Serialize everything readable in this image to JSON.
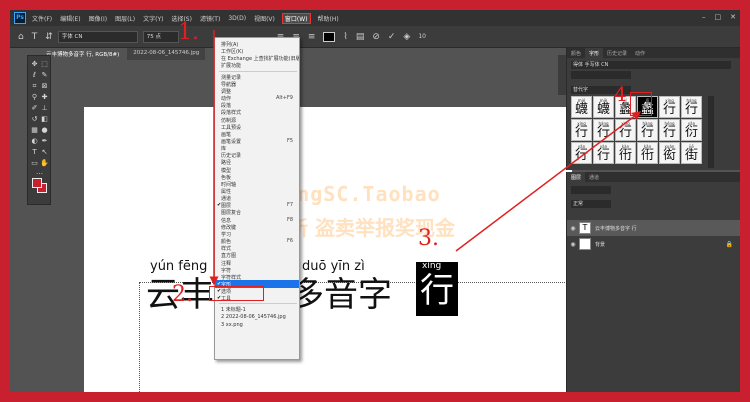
{
  "menubar": {
    "logo": "Ps",
    "items": [
      "文件(F)",
      "编辑(E)",
      "图像(I)",
      "图层(L)",
      "文字(Y)",
      "选择(S)",
      "滤镜(T)",
      "3D(D)",
      "视图(V)",
      "窗口(W)",
      "帮助(H)"
    ],
    "active_index": 9
  },
  "options": {
    "font": "字体 CN",
    "size": "75 点",
    "number": "10"
  },
  "doc_tabs": [
    "云丰博物多音字 行, RGB/8#)",
    "2022-08-06_145746.jpg"
  ],
  "canvas": {
    "pinyin_line": "yún fēng",
    "pinyin_line2": "duō yīn zì",
    "pinyin_sel": "xíng",
    "hanzi_left": "云丰",
    "hanzi_mid": "多音字",
    "hanzi_sel": "行",
    "watermark_1": "YunFengSC.Taobao",
    "watermark_2": "支持更新 盗卖举报奖现金"
  },
  "window_menu": {
    "items": [
      {
        "label": "排列(A)",
        "shortcut": ""
      },
      {
        "label": "工作区(K)",
        "shortcut": ""
      },
      {
        "label": "在 Exchange 上查找扩展功能(旧版)...",
        "shortcut": ""
      },
      {
        "label": "扩展功能",
        "shortcut": ""
      },
      {
        "label": "测量记录",
        "shortcut": ""
      },
      {
        "label": "导航器",
        "shortcut": ""
      },
      {
        "label": "调整",
        "shortcut": ""
      },
      {
        "label": "动作",
        "shortcut": "Alt+F9"
      },
      {
        "label": "段落",
        "shortcut": ""
      },
      {
        "label": "段落样式",
        "shortcut": ""
      },
      {
        "label": "仿制源",
        "shortcut": ""
      },
      {
        "label": "工具预设",
        "shortcut": ""
      },
      {
        "label": "画笔",
        "shortcut": ""
      },
      {
        "label": "画笔设置",
        "shortcut": "F5"
      },
      {
        "label": "库",
        "shortcut": ""
      },
      {
        "label": "历史记录",
        "shortcut": ""
      },
      {
        "label": "路径",
        "shortcut": ""
      },
      {
        "label": "模型",
        "shortcut": ""
      },
      {
        "label": "色板",
        "shortcut": ""
      },
      {
        "label": "时间轴",
        "shortcut": ""
      },
      {
        "label": "属性",
        "shortcut": ""
      },
      {
        "label": "通道",
        "shortcut": ""
      },
      {
        "label": "图层",
        "shortcut": "F7"
      },
      {
        "label": "图层复合",
        "shortcut": ""
      },
      {
        "label": "信息",
        "shortcut": "F8"
      },
      {
        "label": "修改键",
        "shortcut": ""
      },
      {
        "label": "学习",
        "shortcut": ""
      },
      {
        "label": "颜色",
        "shortcut": "F6"
      },
      {
        "label": "样式",
        "shortcut": ""
      },
      {
        "label": "直方图",
        "shortcut": ""
      },
      {
        "label": "注释",
        "shortcut": ""
      },
      {
        "label": "字符",
        "shortcut": ""
      },
      {
        "label": "字符样式",
        "shortcut": ""
      },
      {
        "label": "字形",
        "shortcut": ""
      },
      {
        "label": "选项",
        "shortcut": ""
      },
      {
        "label": "工具",
        "shortcut": ""
      },
      {
        "label": "1 未标题-1",
        "shortcut": ""
      },
      {
        "label": "2 2022-08-06_145746.jpg",
        "shortcut": ""
      },
      {
        "label": "3 xx.png",
        "shortcut": ""
      }
    ],
    "checked": [
      22,
      33,
      34,
      35
    ],
    "highlight_index": 33
  },
  "glyph_panel": {
    "tabs": [
      "颜色",
      "字形",
      "历史记录",
      "动作"
    ],
    "active_tab": 1,
    "font": "得体 手写体 CN",
    "filter": "替代字",
    "glyphs": [
      {
        "py": "mié",
        "ch": "蠛"
      },
      {
        "py": "miè",
        "ch": "蠛"
      },
      {
        "py": "lí",
        "ch": "蠡"
      },
      {
        "py": "lǐ",
        "ch": "蠡"
      },
      {
        "py": "xíng",
        "ch": "行"
      },
      {
        "py": "háng",
        "ch": "行"
      },
      {
        "py": "xíng",
        "ch": "行"
      },
      {
        "py": "háng",
        "ch": "行"
      },
      {
        "py": "xìng",
        "ch": "行"
      },
      {
        "py": "hàng",
        "ch": "行"
      },
      {
        "py": "héng",
        "ch": "行"
      },
      {
        "py": "yǎn",
        "ch": "衍"
      },
      {
        "py": "yǎn",
        "ch": "行"
      },
      {
        "py": "yán",
        "ch": "行"
      },
      {
        "py": "kàn",
        "ch": "衎"
      },
      {
        "py": "kǎn",
        "ch": "衎"
      },
      {
        "py": "xuàn",
        "ch": "衒"
      },
      {
        "py": "jiē",
        "ch": "街"
      }
    ],
    "selected_glyph": 3
  },
  "layers_panel": {
    "tabs": [
      "图层",
      "通道"
    ],
    "blend": "正常",
    "layers": [
      {
        "name": "云丰博物多音字 行",
        "thumb": "T",
        "selected": true
      },
      {
        "name": "背景",
        "thumb": "",
        "selected": false
      }
    ]
  },
  "annotations": {
    "n1": "1.",
    "n2": "2.",
    "n3": "3.",
    "n4": "4"
  }
}
